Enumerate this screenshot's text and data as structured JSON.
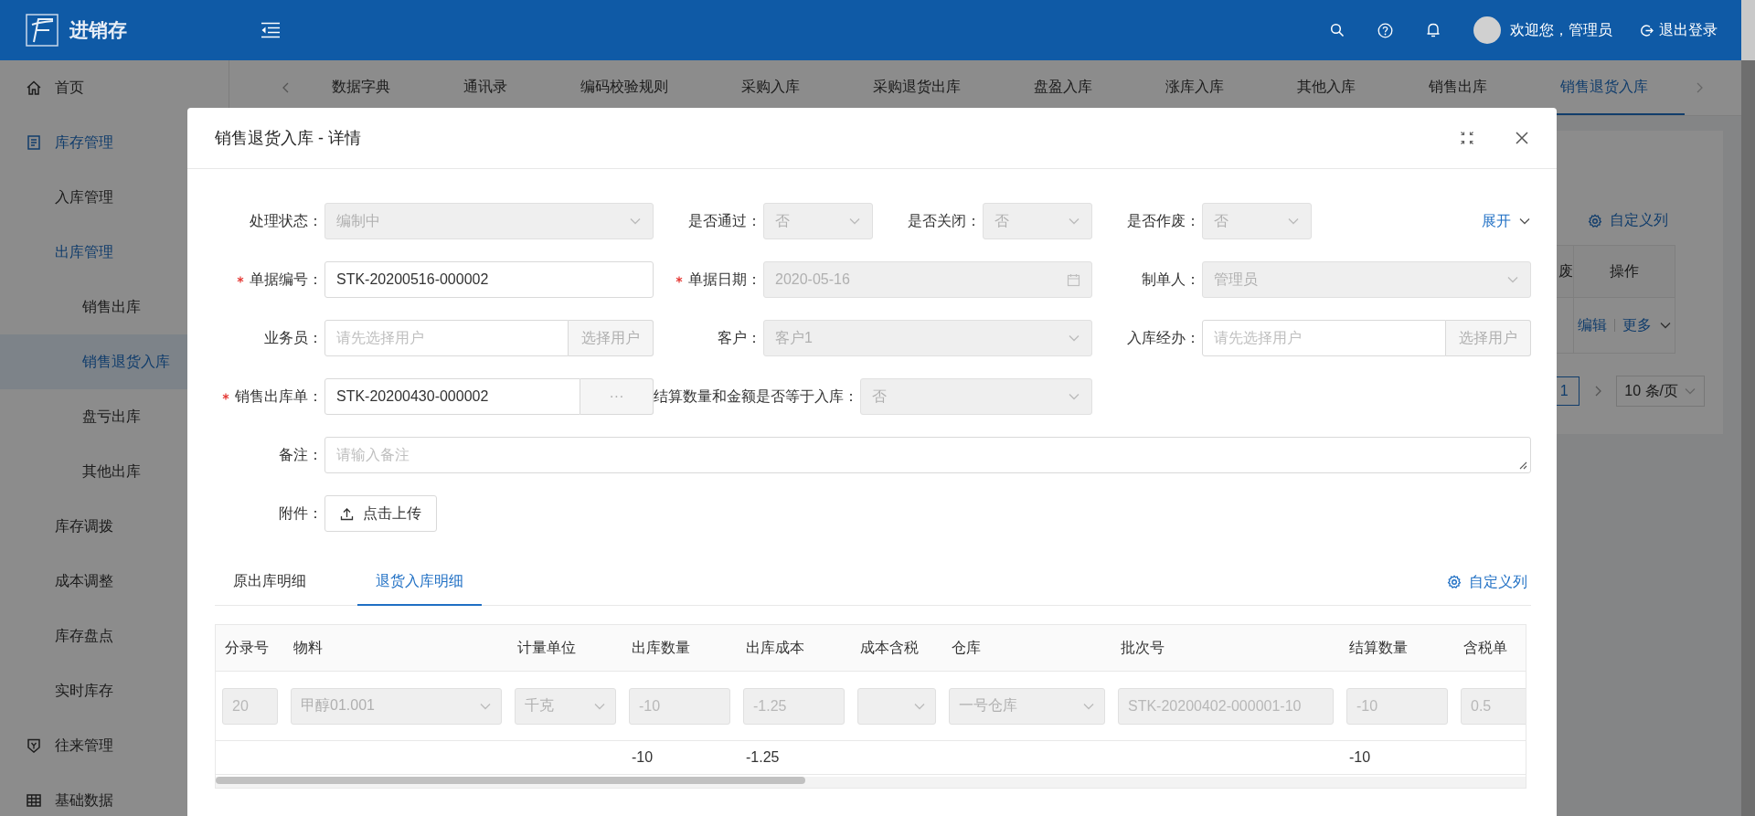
{
  "header": {
    "app_name": "进销存",
    "welcome": "欢迎您，管理员",
    "logout": "退出登录"
  },
  "sidebar": {
    "items": [
      {
        "label": "首页",
        "selected": false
      },
      {
        "label": "库存管理",
        "selected": false,
        "expanded": true,
        "children": [
          {
            "label": "入库管理",
            "selected": false,
            "expanded": false
          },
          {
            "label": "出库管理",
            "selected": false,
            "expanded": true,
            "children": [
              {
                "label": "销售出库",
                "selected": false
              },
              {
                "label": "销售退货入库",
                "selected": true
              },
              {
                "label": "盘亏出库",
                "selected": false
              },
              {
                "label": "其他出库",
                "selected": false
              }
            ]
          },
          {
            "label": "库存调拨",
            "selected": false
          },
          {
            "label": "成本调整",
            "selected": false
          },
          {
            "label": "库存盘点",
            "selected": false
          },
          {
            "label": "实时库存",
            "selected": false
          }
        ]
      },
      {
        "label": "往来管理",
        "selected": false,
        "expanded": false
      },
      {
        "label": "基础数据",
        "selected": false,
        "expanded": false
      }
    ]
  },
  "tabs": [
    {
      "label": "数据字典",
      "selected": false
    },
    {
      "label": "通讯录",
      "selected": false
    },
    {
      "label": "编码校验规则",
      "selected": false
    },
    {
      "label": "采购入库",
      "selected": false
    },
    {
      "label": "采购退货出库",
      "selected": false
    },
    {
      "label": "盘盈入库",
      "selected": false
    },
    {
      "label": "涨库入库",
      "selected": false
    },
    {
      "label": "其他入库",
      "selected": false
    },
    {
      "label": "销售出库",
      "selected": false
    },
    {
      "label": "销售退货入库",
      "selected": true
    }
  ],
  "page": {
    "custom_columns": "自定义列",
    "table_columns": [
      "废",
      "操作"
    ],
    "row_actions": [
      "编辑",
      "更多"
    ],
    "pagination": {
      "pages": [
        {
          "label": "1",
          "selected": true
        }
      ],
      "page_size": "10 条/页"
    }
  },
  "modal": {
    "title": "销售退货入库 - 详情",
    "expand_link": "展开",
    "form": {
      "rows": [
        [
          {
            "label": "处理状态：",
            "kind": "select",
            "value": "编制中",
            "disabled": true,
            "required": false
          },
          {
            "label": "是否通过：",
            "kind": "select",
            "value": "否",
            "disabled": true,
            "required": false
          },
          {
            "label": "是否关闭：",
            "kind": "select",
            "value": "否",
            "disabled": true,
            "required": false
          },
          {
            "label": "是否作废：",
            "kind": "select",
            "value": "否",
            "disabled": true,
            "required": false
          }
        ],
        [
          {
            "label": "单据编号：",
            "kind": "input",
            "value": "STK-20200516-000002",
            "disabled": false,
            "required": true
          },
          {
            "label": "单据日期：",
            "kind": "date",
            "value": "2020-05-16",
            "disabled": true,
            "required": true
          },
          {
            "label": "制单人：",
            "kind": "select",
            "value": "管理员",
            "disabled": true,
            "required": false
          }
        ],
        [
          {
            "label": "业务员：",
            "kind": "picker",
            "placeholder": "请先选择用户",
            "button": "选择用户",
            "disabled": false,
            "required": false
          },
          {
            "label": "客户：",
            "kind": "select",
            "value": "客户1",
            "disabled": true,
            "required": false
          },
          {
            "label": "入库经办：",
            "kind": "picker",
            "placeholder": "请先选择用户",
            "button": "选择用户",
            "disabled": false,
            "required": false
          }
        ],
        [
          {
            "label": "销售出库单：",
            "kind": "picker",
            "value": "STK-20200430-000002",
            "button": "···",
            "disabled": false,
            "required": true
          },
          {
            "label": "结算数量和金额是否等于入库：",
            "kind": "select",
            "value": "否",
            "disabled": true,
            "required": false
          }
        ],
        [
          {
            "label": "备注：",
            "kind": "textarea",
            "placeholder": "请输入备注",
            "disabled": false,
            "required": false
          }
        ],
        [
          {
            "label": "附件：",
            "kind": "upload",
            "button": "点击上传",
            "disabled": false,
            "required": false
          }
        ]
      ]
    },
    "detail_tabs": [
      {
        "label": "原出库明细",
        "selected": false
      },
      {
        "label": "退货入库明细",
        "selected": true
      }
    ],
    "custom_columns": "自定义列",
    "table": {
      "columns": [
        {
          "label": "分录号"
        },
        {
          "label": "物料"
        },
        {
          "label": "计量单位"
        },
        {
          "label": "出库数量",
          "total": "-10"
        },
        {
          "label": "出库成本",
          "total": "-1.25"
        },
        {
          "label": "成本含税"
        },
        {
          "label": "仓库"
        },
        {
          "label": "批次号"
        },
        {
          "label": "结算数量",
          "total": "-10"
        },
        {
          "label": "含税单"
        }
      ],
      "rows": [
        {
          "disabled": true,
          "cells": [
            {
              "kind": "input",
              "value": "20"
            },
            {
              "kind": "select",
              "value": "甲醇01.001"
            },
            {
              "kind": "select",
              "value": "千克"
            },
            {
              "kind": "input",
              "value": "-10"
            },
            {
              "kind": "input",
              "value": "-1.25"
            },
            {
              "kind": "select"
            },
            {
              "kind": "select",
              "value": "一号仓库"
            },
            {
              "kind": "input",
              "value": "STK-20200402-000001-10"
            },
            {
              "kind": "input",
              "value": "-10"
            },
            {
              "kind": "input",
              "value": "0.5"
            }
          ]
        }
      ]
    }
  }
}
